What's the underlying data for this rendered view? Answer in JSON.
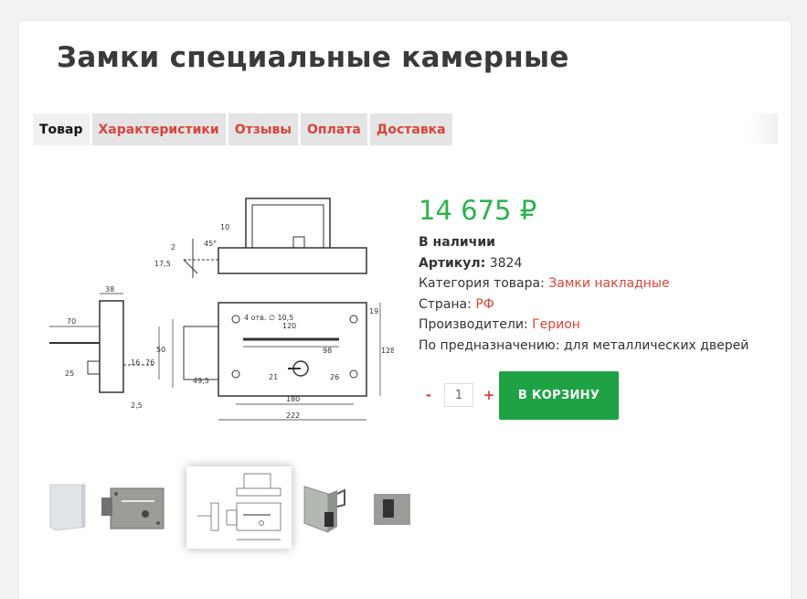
{
  "product": {
    "title": "Замки специальные камерные"
  },
  "tabs": [
    {
      "label": "Товар",
      "active": true
    },
    {
      "label": "Характеристики",
      "active": false
    },
    {
      "label": "Отзывы",
      "active": false
    },
    {
      "label": "Оплата",
      "active": false
    },
    {
      "label": "Доставка",
      "active": false
    }
  ],
  "drawing": {
    "dims": [
      "10",
      "2",
      "45°",
      "17,5",
      "38",
      "70",
      "76",
      "50",
      "16",
      "25",
      "2,5",
      "49,5",
      "4 отв. ∅ 10,5",
      "120",
      "98",
      "19",
      "128",
      "21",
      "26",
      "180",
      "222"
    ]
  },
  "price": "14 675 ₽",
  "stock": "В наличии",
  "details": {
    "sku_label": "Артикул:",
    "sku_value": "3824",
    "category_label": "Категория товара:",
    "category_value": "Замки накладные",
    "country_label": "Страна:",
    "country_value": "РФ",
    "maker_label": "Производители:",
    "maker_value": "Герион",
    "purpose_label": "По предназначению:",
    "purpose_value": "для металлических дверей"
  },
  "quantity": {
    "minus": "-",
    "value": "1",
    "plus": "+"
  },
  "cart_button": "В КОРЗИНУ",
  "colors": {
    "accent": "#d9443a",
    "price": "#2bb34a",
    "cart": "#1fa246"
  },
  "thumbnails": [
    "lock-side-photo",
    "lock-front-photo",
    "lock-drawing",
    "lock-angle-photo",
    "lock-detail-photo"
  ]
}
